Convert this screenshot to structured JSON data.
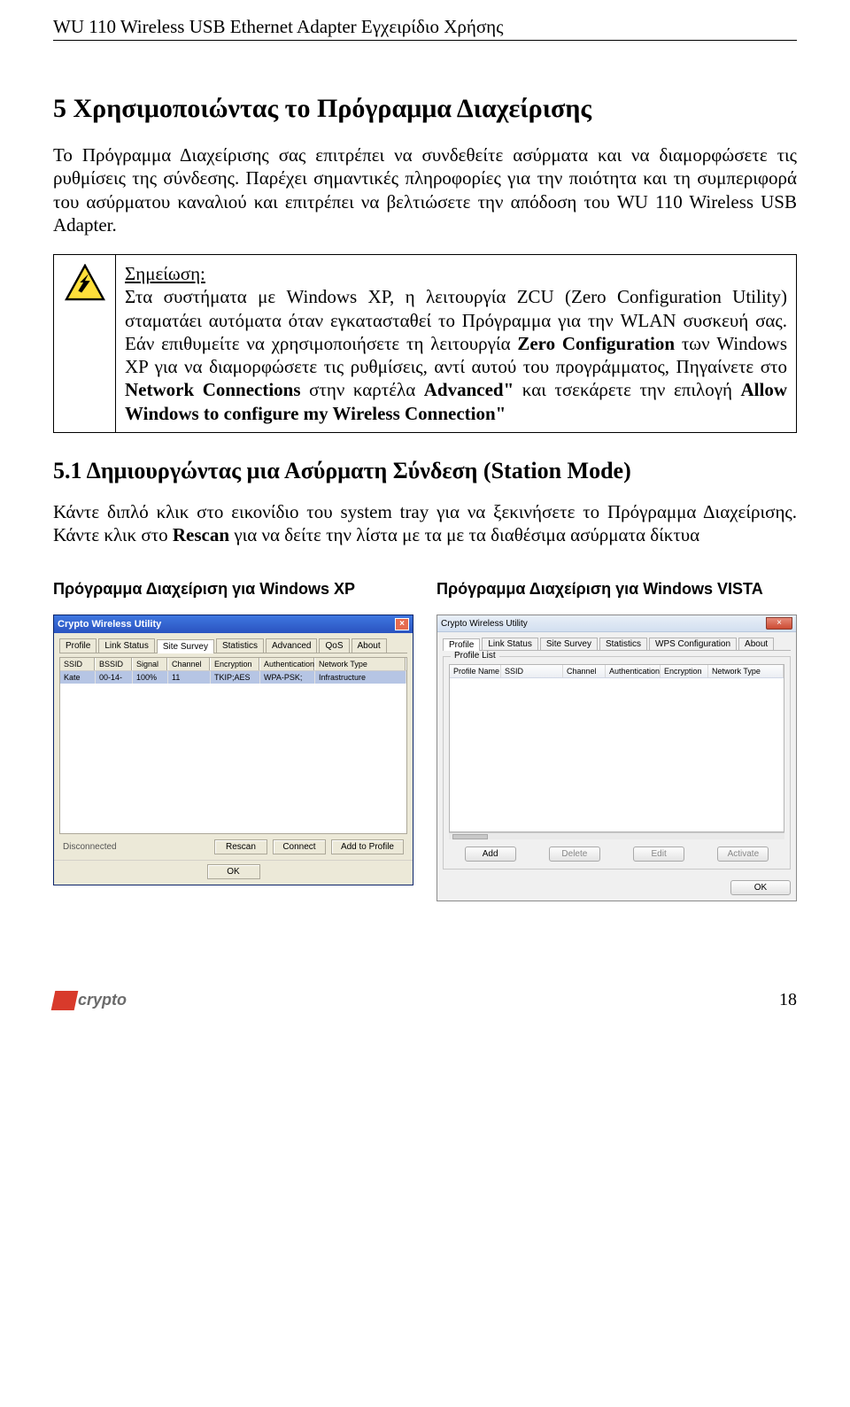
{
  "header": {
    "text": "WU 110 Wireless USB Ethernet Adapter Εγχειρίδιο Χρήσης"
  },
  "section": {
    "title": "5  Χρησιμοποιώντας το Πρόγραμμα Διαχείρισης",
    "intro": "Το Πρόγραμμα Διαχείρισης σας επιτρέπει να συνδεθείτε ασύρματα και να διαμορφώσετε τις ρυθμίσεις της σύνδεσης. Παρέχει σημαντικές πληροφορίες για την ποιότητα και τη συμπεριφορά του ασύρματου καναλιού και επιτρέπει να βελτιώσετε την απόδοση του WU 110 Wireless USB Adapter."
  },
  "note": {
    "label": "Σημείωση:",
    "body_pre": "Στα συστήματα με Windows XP, η λειτουργία ZCU (Zero Configuration Utility) σταματάει αυτόματα όταν εγκατασταθεί το Πρόγραμμα για την WLAN συσκευή σας. Εάν επιθυμείτε να χρησιμοποιήσετε τη λειτουργία ",
    "bold1": "Zero Configuration",
    "mid1": " των Windows XP για να διαμορφώσετε τις ρυθμίσεις, αντί αυτού του προγράμματος, Πηγαίνετε στο ",
    "bold2": "Network Connections",
    "mid2": " στην καρτέλα ",
    "bold3": "Advanced\"",
    "mid3": " και τσεκάρετε την επιλογή ",
    "bold4": "Allow Windows to configure my Wireless Connection\""
  },
  "subsection": {
    "title": "5.1 Δημιουργώντας μια Ασύρματη Σύνδεση (Station Mode)",
    "para_pre": "Κάντε διπλό κλικ στο εικονίδιο του system tray για να ξεκινήσετε το Πρόγραμμα Διαχείρισης. Κάντε κλικ στο ",
    "para_bold": "Rescan",
    "para_post": " για να δείτε την λίστα με τα με τα διαθέσιμα ασύρματα δίκτυα"
  },
  "columns": {
    "xp_heading": "Πρόγραμμα Διαχείριση για Windows XP",
    "vista_heading": "Πρόγραμμα Διαχείριση για Windows VISTA"
  },
  "xp": {
    "title": "Crypto Wireless Utility",
    "tabs": [
      "Profile",
      "Link Status",
      "Site Survey",
      "Statistics",
      "Advanced",
      "QoS",
      "About"
    ],
    "active_tab_index": 2,
    "headers": [
      "SSID",
      "BSSID",
      "Signal",
      "Channel",
      "Encryption",
      "Authentication",
      "Network Type"
    ],
    "row": {
      "ssid": "Kate",
      "bssid": "00-14-",
      "signal": "100%",
      "channel": "11",
      "encryption": "TKIP;AES",
      "auth": "WPA-PSK;",
      "net": "Infrastructure"
    },
    "status": "Disconnected",
    "btn_rescan": "Rescan",
    "btn_connect": "Connect",
    "btn_addprof": "Add to Profile",
    "btn_ok": "OK"
  },
  "vista": {
    "title": "Crypto Wireless Utility",
    "tabs": [
      "Profile",
      "Link Status",
      "Site Survey",
      "Statistics",
      "WPS Configuration",
      "About"
    ],
    "active_tab_index": 0,
    "group_label": "Profile List",
    "headers": [
      "Profile Name",
      "SSID",
      "Channel",
      "Authentication",
      "Encryption",
      "Network Type"
    ],
    "btn_add": "Add",
    "btn_delete": "Delete",
    "btn_edit": "Edit",
    "btn_activate": "Activate",
    "btn_ok": "OK"
  },
  "footer": {
    "logo_text": "crypto",
    "page": "18"
  }
}
